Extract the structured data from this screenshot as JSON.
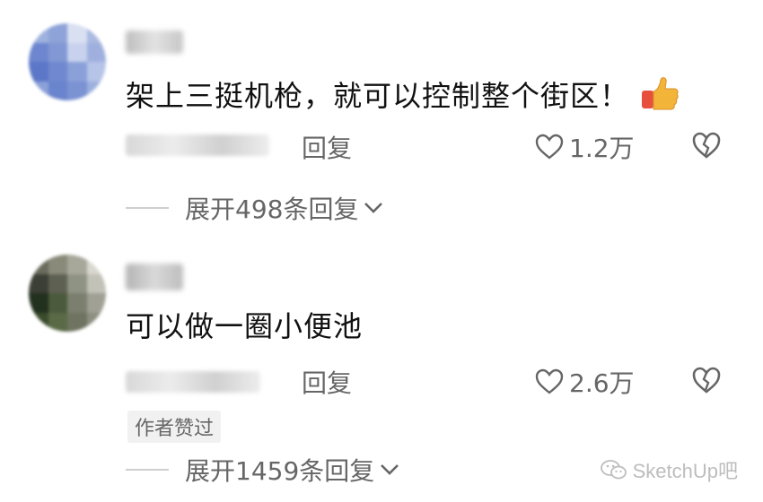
{
  "comments": [
    {
      "text": "架上三挺机枪，就可以控制整个街区！",
      "emoji": "thumbs-up-icon",
      "reply_label": "回复",
      "likes": "1.2万",
      "expand_label": "展开498条回复"
    },
    {
      "text": "可以做一圈小便池",
      "reply_label": "回复",
      "likes": "2.6万",
      "badge": "作者赞过",
      "expand_label": "展开1459条回复"
    }
  ],
  "watermark": {
    "text": "SketchUp吧",
    "icon": "wechat-icon"
  },
  "colors": {
    "text": "#111111",
    "muted": "#666666",
    "thumb": "#f3b43a",
    "sleeve": "#e8503e"
  }
}
